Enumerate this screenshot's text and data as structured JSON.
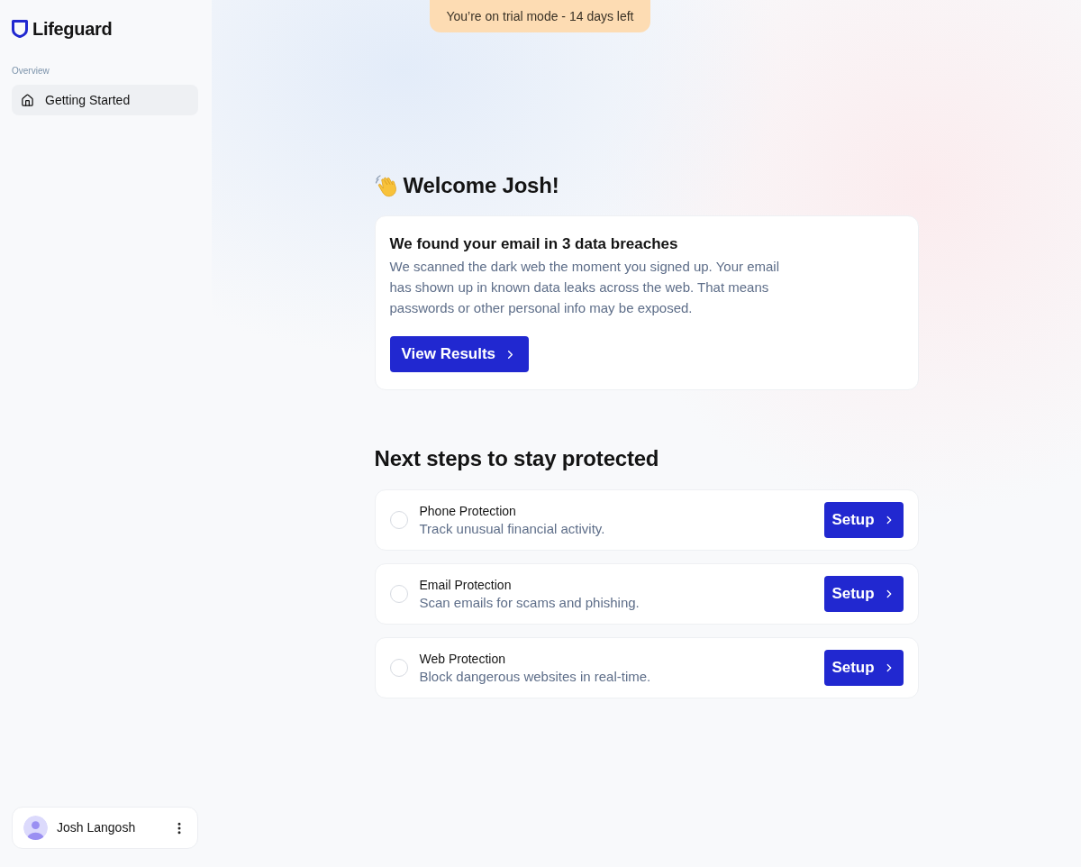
{
  "banner": {
    "text": "You’re on trial mode - 14 days left"
  },
  "sidebar": {
    "logo": "Lifeguard",
    "section": "Overview",
    "items": [
      {
        "label": "Getting Started",
        "selected": true
      }
    ],
    "user": {
      "name": "Josh Langosh"
    }
  },
  "welcome": {
    "title": "Welcome Josh!"
  },
  "alert": {
    "title": "We found your email in 3 data breaches",
    "body": "We scanned the dark web the moment you signed up. Your email has shown up in known data leaks across the web. That means passwords or other personal info may be exposed.",
    "button": "View Results"
  },
  "next_steps": {
    "title": "Next steps to stay protected",
    "steps": [
      {
        "title": "Phone Protection",
        "description": "Track unusual financial activity.",
        "done": false,
        "button": "Setup"
      },
      {
        "title": "Email Protection",
        "description": "Scan emails for scams and phishing.",
        "done": false,
        "button": "Setup"
      },
      {
        "title": "Web Protection",
        "description": "Block dangerous websites in real-time.",
        "done": false,
        "button": "Setup"
      }
    ]
  }
}
